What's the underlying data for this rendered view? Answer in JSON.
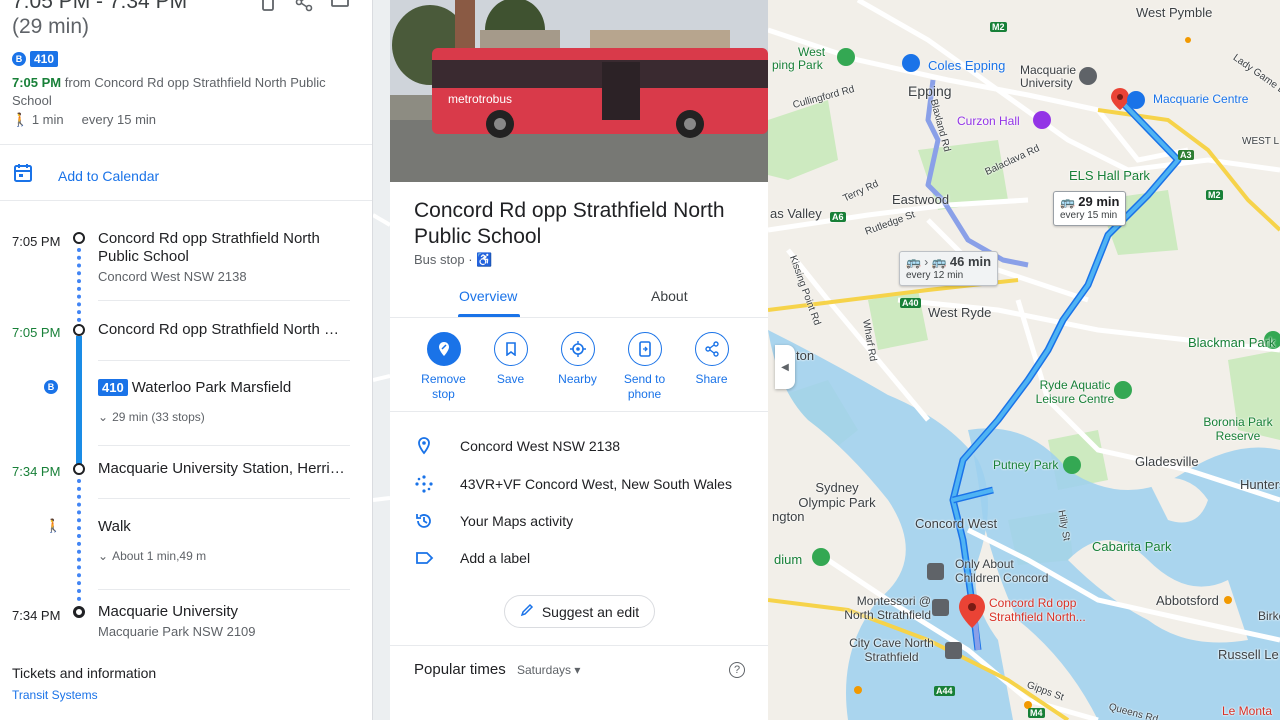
{
  "directions": {
    "time_range": "7:05 PM - 7:34 PM",
    "duration": "(29 min)",
    "bus_badge_letter": "B",
    "route_number": "410",
    "departure_time": "7:05 PM",
    "departure_text": "from Concord Rd opp Strathfield North Public School",
    "walk_minutes": "1 min",
    "frequency": "every 15 min",
    "add_calendar": "Add to Calendar",
    "steps": {
      "s1_time": "7:05 PM",
      "s1_title": "Concord Rd opp Strathfield North Public School",
      "s1_sub": "Concord West NSW 2138",
      "s2_time": "7:05 PM",
      "s2_title": "Concord Rd opp Strathfield North Public School",
      "s2_route": "410",
      "s2_dest": "Waterloo Park Marsfield",
      "s2_stops": "29 min (33 stops)",
      "s3_time": "7:34 PM",
      "s3_title": "Macquarie University Station, Herring Rd",
      "s4_title": "Walk",
      "s4_detail": "About 1 min,49 m",
      "s5_time": "7:34 PM",
      "s5_title": "Macquarie University",
      "s5_sub": "Macquarie Park NSW 2109"
    },
    "tickets_heading": "Tickets and information",
    "transit_link": "Transit Systems"
  },
  "place": {
    "photo_bus_text": "metrotrobus",
    "title": "Concord Rd opp Strathfield North Public School",
    "type": "Bus stop ·",
    "tabs": [
      "Overview",
      "About"
    ],
    "actions": [
      {
        "label": "Remove stop",
        "icon": "remove-stop-icon"
      },
      {
        "label": "Save",
        "icon": "bookmark-icon"
      },
      {
        "label": "Nearby",
        "icon": "nearby-icon"
      },
      {
        "label": "Send to phone",
        "icon": "send-to-phone-icon"
      },
      {
        "label": "Share",
        "icon": "share-icon"
      }
    ],
    "address": "Concord West NSW 2138",
    "plus_code": "43VR+VF Concord West, New South Wales",
    "maps_activity": "Your Maps activity",
    "add_label": "Add a label",
    "suggest_edit": "Suggest an edit",
    "popular_times": "Popular times",
    "popular_day": "Saturdays",
    "help": "?"
  },
  "map": {
    "labels": {
      "west_pymble": "West Pymble",
      "west": "West",
      "ping_park": "ping Park",
      "coles": "Coles Epping",
      "macquarie_uni": "Macquarie University",
      "macquarie_centre": "Macquarie Centre",
      "lady_game": "Lady Game Dr",
      "epping": "Epping",
      "cullingford": "Cullingford Rd",
      "curzon": "Curzon Hall",
      "blaxland": "Blaxland Rd",
      "balaclava": "Balaclava Rd",
      "els": "ELS Hall Park",
      "west_right": "WEST L",
      "terry": "Terry Rd",
      "eastwood": "Eastwood",
      "as_valley": "as Valley",
      "rutledge": "Rutledge St",
      "kissing": "Kissing Point Rd",
      "wharf": "Wharf Rd",
      "west_ryde": "West Ryde",
      "ton": "ton",
      "blackman": "Blackman Park",
      "ryde_aquatic": "Ryde Aquatic Leisure Centre",
      "boronia": "Boronia Park Reserve",
      "putney": "Putney Park",
      "gladesville": "Gladesville",
      "sydney_olympic": "Sydney Olympic Park",
      "hunters": "Hunters H",
      "ngton": "ngton",
      "concord_west": "Concord West",
      "hilly": "Hilly St",
      "cabarita": "Cabarita Park",
      "dium": "dium",
      "only_about": "Only About Children Concord",
      "montessori": "Montessori @ North Strathfield",
      "concord_stop": "Concord Rd opp Strathfield North...",
      "abbotsford": "Abbotsford",
      "birke": "Birke",
      "city_cave": "City Cave North Strathfield",
      "russell": "Russell Le",
      "gipps": "Gipps St",
      "le_monta": "Le Monta",
      "queens": "Queens Rd"
    },
    "shields": [
      "M2",
      "A3",
      "M2",
      "A6",
      "A40",
      "A44",
      "M4"
    ],
    "trip1_time": "29 min",
    "trip1_freq": "every 15 min",
    "trip2_time": "46 min",
    "trip2_freq": "every 12 min"
  }
}
